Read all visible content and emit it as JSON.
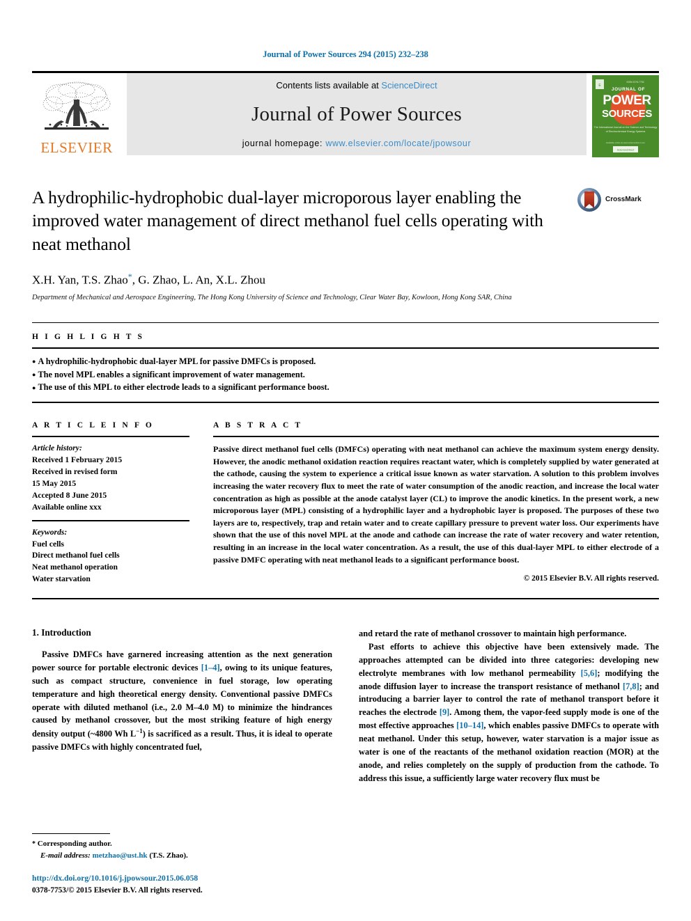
{
  "header": {
    "citation": "Journal of Power Sources 294 (2015) 232–238",
    "contents_prefix": "Contents lists available at ",
    "sciencedirect": "ScienceDirect",
    "journal_title": "Journal of Power Sources",
    "homepage_prefix": "journal homepage: ",
    "homepage_url": "www.elsevier.com/locate/jpowsour",
    "publisher": "ELSEVIER",
    "cover_lines": {
      "top": "JOURNAL OF",
      "main1": "POWER",
      "main2": "SOURCES"
    },
    "link_color": "#3a8cc8",
    "band_color": "#e6e6e6",
    "elsevier_orange": "#e87722"
  },
  "article": {
    "title": "A hydrophilic-hydrophobic dual-layer microporous layer enabling the improved water management of direct methanol fuel cells operating with neat methanol",
    "crossmark_label": "CrossMark",
    "authors": "X.H. Yan, T.S. Zhao",
    "authors_rest": ", G. Zhao, L. An, X.L. Zhou",
    "corresponding_mark": "*",
    "affiliation": "Department of Mechanical and Aerospace Engineering, The Hong Kong University of Science and Technology, Clear Water Bay, Kowloon, Hong Kong SAR, China"
  },
  "highlights": {
    "heading": "H I G H L I G H T S",
    "items": [
      "A hydrophilic-hydrophobic dual-layer MPL for passive DMFCs is proposed.",
      "The novel MPL enables a significant improvement of water management.",
      "The use of this MPL to either electrode leads to a significant performance boost."
    ]
  },
  "article_info": {
    "heading": "A R T I C L E  I N F O",
    "history_label": "Article history:",
    "history": [
      "Received 1 February 2015",
      "Received in revised form",
      "15 May 2015",
      "Accepted 8 June 2015",
      "Available online xxx"
    ],
    "keywords_label": "Keywords:",
    "keywords": [
      "Fuel cells",
      "Direct methanol fuel cells",
      "Neat methanol operation",
      "Water starvation"
    ]
  },
  "abstract": {
    "heading": "A B S T R A C T",
    "text": "Passive direct methanol fuel cells (DMFCs) operating with neat methanol can achieve the maximum system energy density. However, the anodic methanol oxidation reaction requires reactant water, which is completely supplied by water generated at the cathode, causing the system to experience a critical issue known as water starvation. A solution to this problem involves increasing the water recovery flux to meet the rate of water consumption of the anodic reaction, and increase the local water concentration as high as possible at the anode catalyst layer (CL) to improve the anodic kinetics. In the present work, a new microporous layer (MPL) consisting of a hydrophilic layer and a hydrophobic layer is proposed. The purposes of these two layers are to, respectively, trap and retain water and to create capillary pressure to prevent water loss. Our experiments have shown that the use of this novel MPL at the anode and cathode can increase the rate of water recovery and water retention, resulting in an increase in the local water concentration. As a result, the use of this dual-layer MPL to either electrode of a passive DMFC operating with neat methanol leads to a significant performance boost.",
    "rights": "© 2015 Elsevier B.V. All rights reserved."
  },
  "body": {
    "section_number_title": "1. Introduction",
    "left_para1_a": "Passive DMFCs have garnered increasing attention as the next generation power source for portable electronic devices ",
    "left_para1_ref1": "[1–4]",
    "left_para1_b": ", owing to its unique features, such as compact structure, convenience in fuel storage, low operating temperature and high theoretical energy density. Conventional passive DMFCs operate with diluted methanol (i.e., 2.0 M–4.0 M) to minimize the hindrances caused by methanol crossover, but the most striking feature of high energy density output (~4800 Wh L",
    "left_para1_sup": "−1",
    "left_para1_c": ") is sacrificed as a result. Thus, it is ideal to operate passive DMFCs with highly concentrated fuel,",
    "right_para1": "and retard the rate of methanol crossover to maintain high performance.",
    "right_para2_a": "Past efforts to achieve this objective have been extensively made. The approaches attempted can be divided into three categories: developing new electrolyte membranes with low methanol permeability ",
    "right_para2_ref1": "[5,6]",
    "right_para2_b": "; modifying the anode diffusion layer to increase the transport resistance of methanol ",
    "right_para2_ref2": "[7,8]",
    "right_para2_c": "; and introducing a barrier layer to control the rate of methanol transport before it reaches the electrode ",
    "right_para2_ref3": "[9]",
    "right_para2_d": ". Among them, the vapor-feed supply mode is one of the most effective approaches ",
    "right_para2_ref4": "[10–14]",
    "right_para2_e": ", which enables passive DMFCs to operate with neat methanol. Under this setup, however, water starvation is a major issue as water is one of the reactants of the methanol oxidation reaction (MOR) at the anode, and relies completely on the supply of production from the cathode. To address this issue, a sufficiently large water recovery flux must be"
  },
  "footer": {
    "corresponding_star": "*",
    "corresponding_label": "Corresponding author.",
    "email_label": "E-mail address:",
    "email": "metzhao@ust.hk",
    "email_suffix": "(T.S. Zhao).",
    "doi": "http://dx.doi.org/10.1016/j.jpowsour.2015.06.058",
    "issn": "0378-7753/© 2015 Elsevier B.V. All rights reserved.",
    "link_color": "#1070a8"
  }
}
